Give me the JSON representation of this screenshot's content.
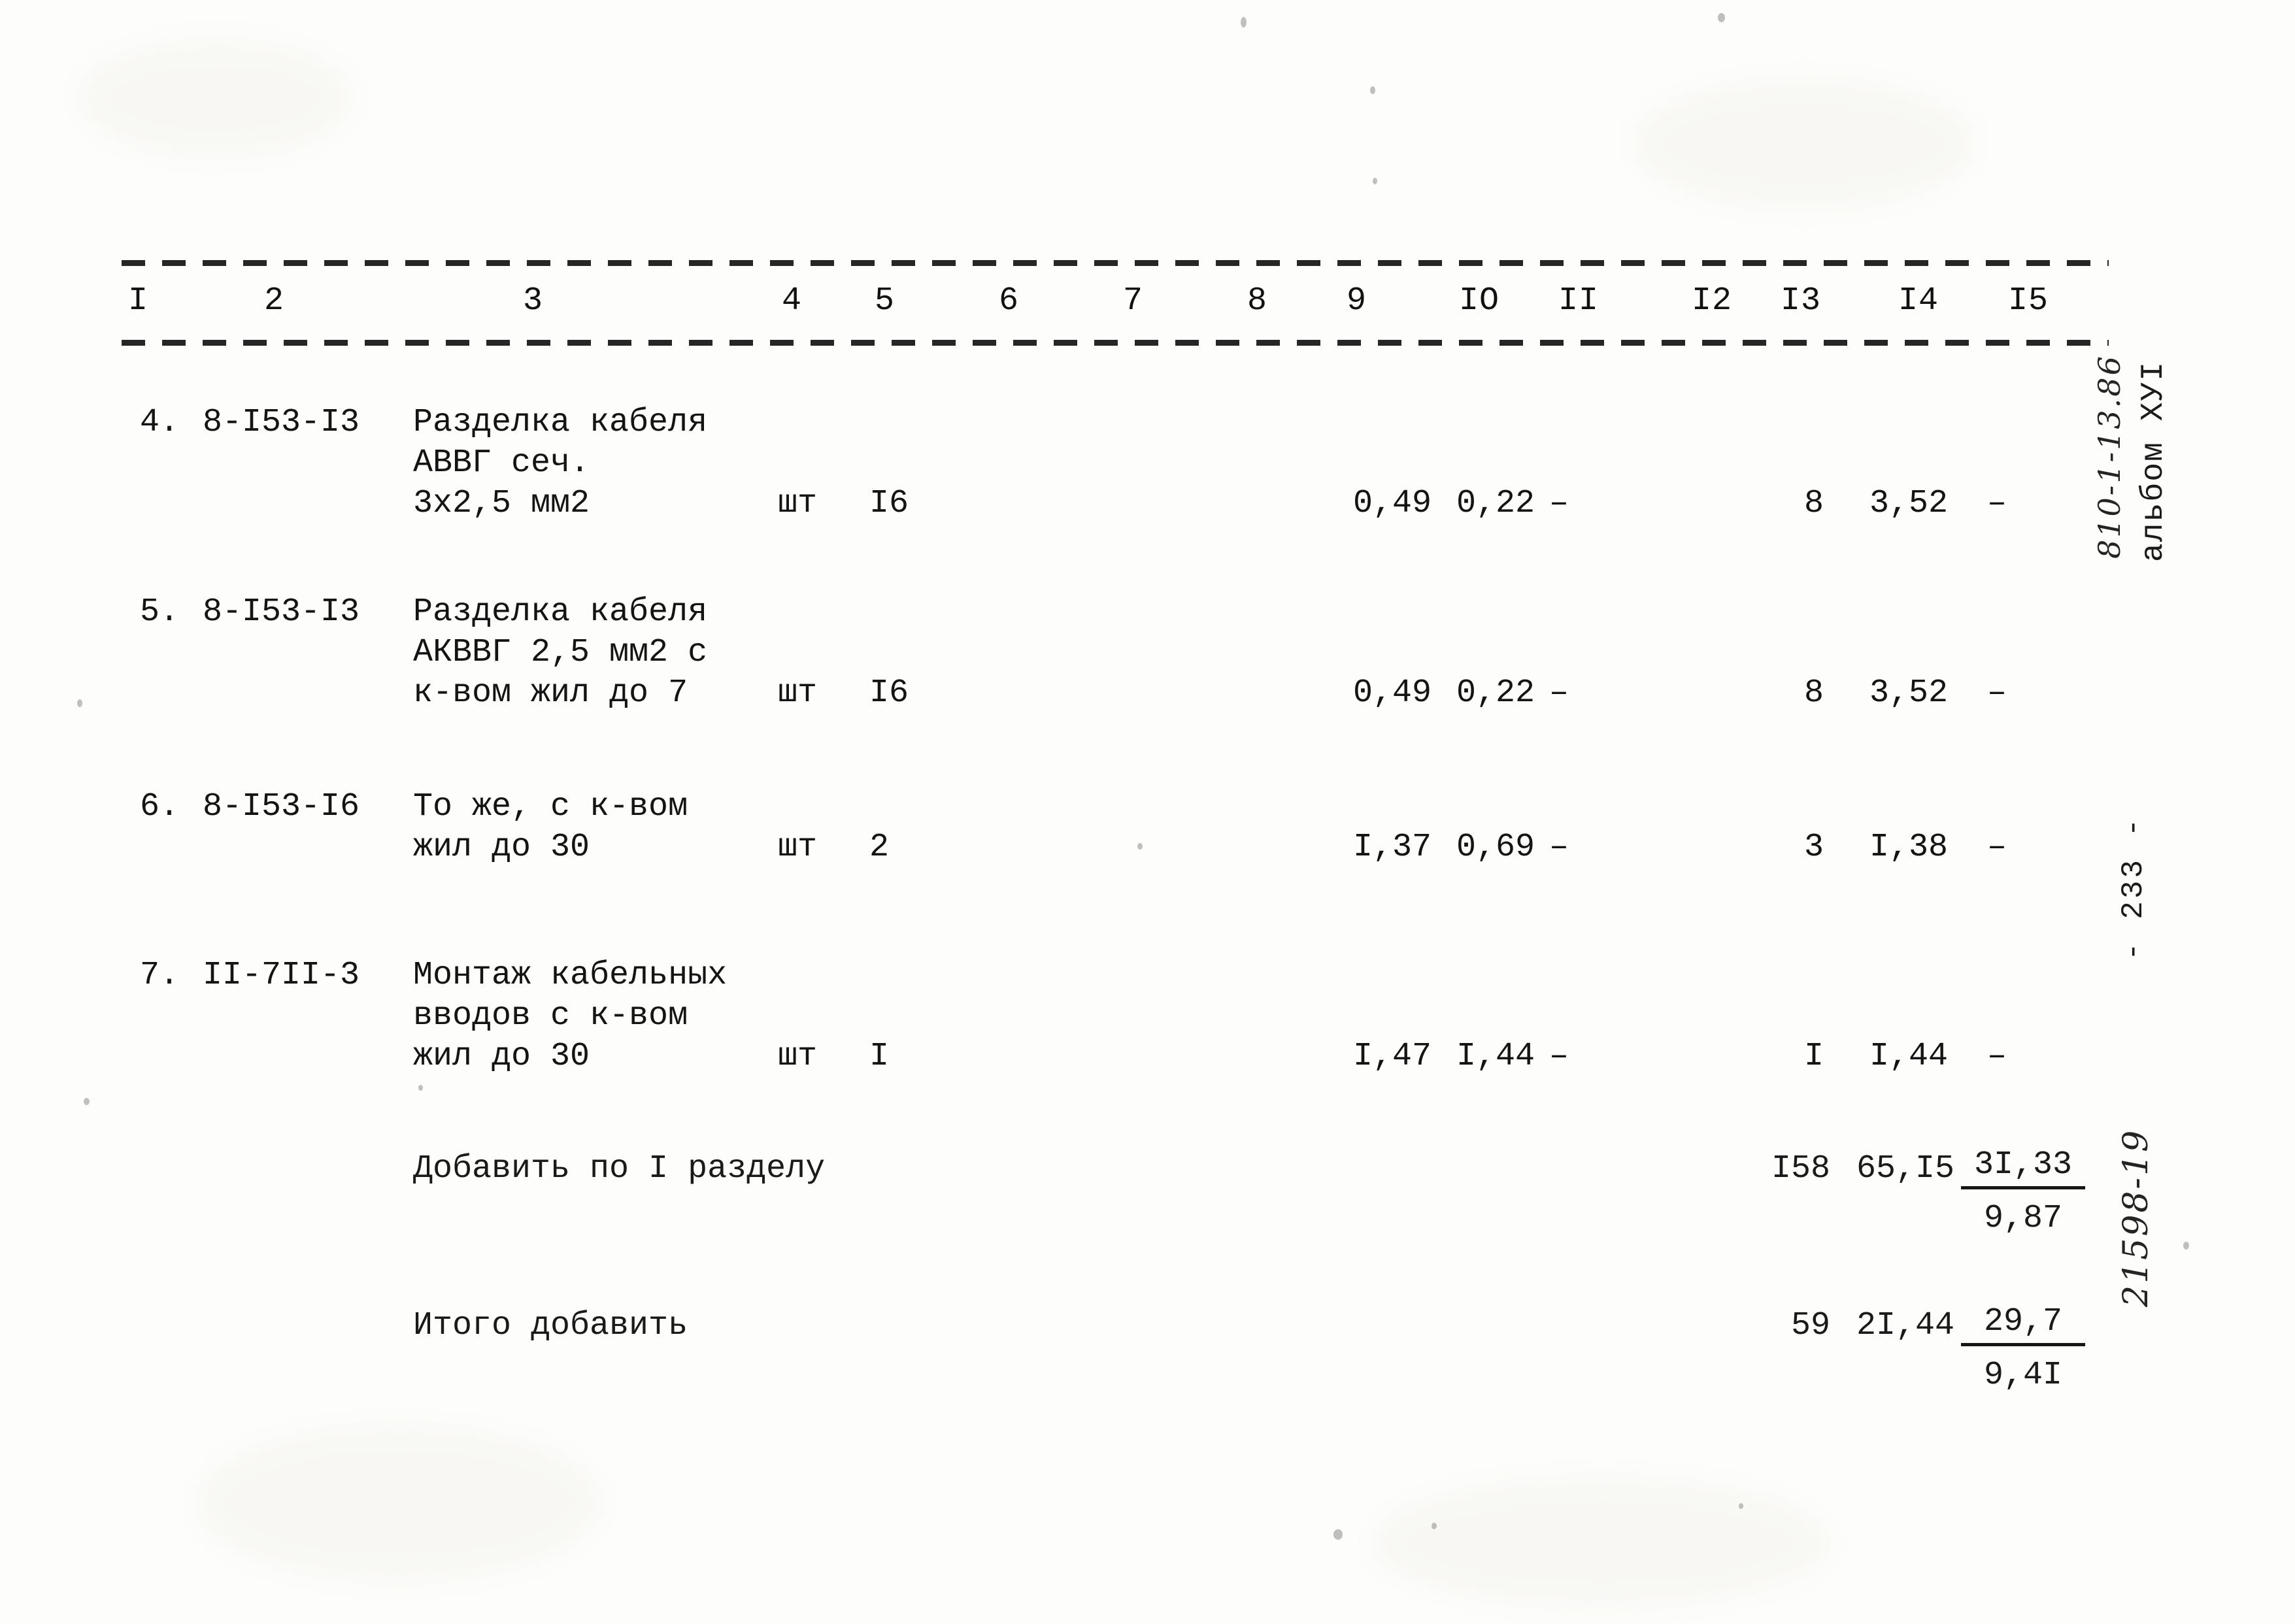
{
  "document": {
    "type": "scanned-estimate-table",
    "language": "ru"
  },
  "table": {
    "column_headers": [
      "I",
      "2",
      "3",
      "4",
      "5",
      "6",
      "7",
      "8",
      "9",
      "IO",
      "II",
      "I2",
      "I3",
      "I4",
      "I5"
    ],
    "rows": [
      {
        "no": "4.",
        "code": "8-I53-I3",
        "description": "Разделка кабеля\nАВВГ сеч.\n3х2,5 мм2",
        "unit": "шт",
        "qty": "I6",
        "c6": "",
        "c7": "",
        "c8": "",
        "c9": "0,49",
        "c10": "0,22",
        "c11": "–",
        "c12": "",
        "c13": "8",
        "c14": "3,52",
        "c15": "–"
      },
      {
        "no": "5.",
        "code": "8-I53-I3",
        "description": "Разделка кабеля\nАКВВГ 2,5 мм2 с\nк-вом жил до 7",
        "unit": "шт",
        "qty": "I6",
        "c6": "",
        "c7": "",
        "c8": "",
        "c9": "0,49",
        "c10": "0,22",
        "c11": "–",
        "c12": "",
        "c13": "8",
        "c14": "3,52",
        "c15": "–"
      },
      {
        "no": "6.",
        "code": "8-I53-I6",
        "description": "То же, с к-вом\nжил до 30",
        "unit": "шт",
        "qty": "2",
        "c6": "",
        "c7": "",
        "c8": "",
        "c9": "I,37",
        "c10": "0,69",
        "c11": "–",
        "c12": "",
        "c13": "3",
        "c14": "I,38",
        "c15": "–"
      },
      {
        "no": "7.",
        "code": "II-7II-3",
        "description": "Монтаж кабельных\nвводов с к-вом\nжил до 30",
        "unit": "шт",
        "qty": "I",
        "c6": "",
        "c7": "",
        "c8": "",
        "c9": "I,47",
        "c10": "I,44",
        "c11": "–",
        "c12": "",
        "c13": "I",
        "c14": "I,44",
        "c15": "–"
      }
    ],
    "summaries": [
      {
        "label": "Добавить по I разделу",
        "c13": "I58",
        "c14": "65,I5",
        "fraction_numerator": "3I,33",
        "fraction_denominator": "9,87"
      },
      {
        "label": "Итого добавить",
        "c13": "59",
        "c14": "2I,44",
        "fraction_numerator": "29,7",
        "fraction_denominator": "9,4I"
      }
    ]
  },
  "marginalia": {
    "album_label": "альбом ХУI",
    "album_code": "810-1-13.86",
    "page_number": "- 233 -",
    "doc_number": "21598-19"
  }
}
